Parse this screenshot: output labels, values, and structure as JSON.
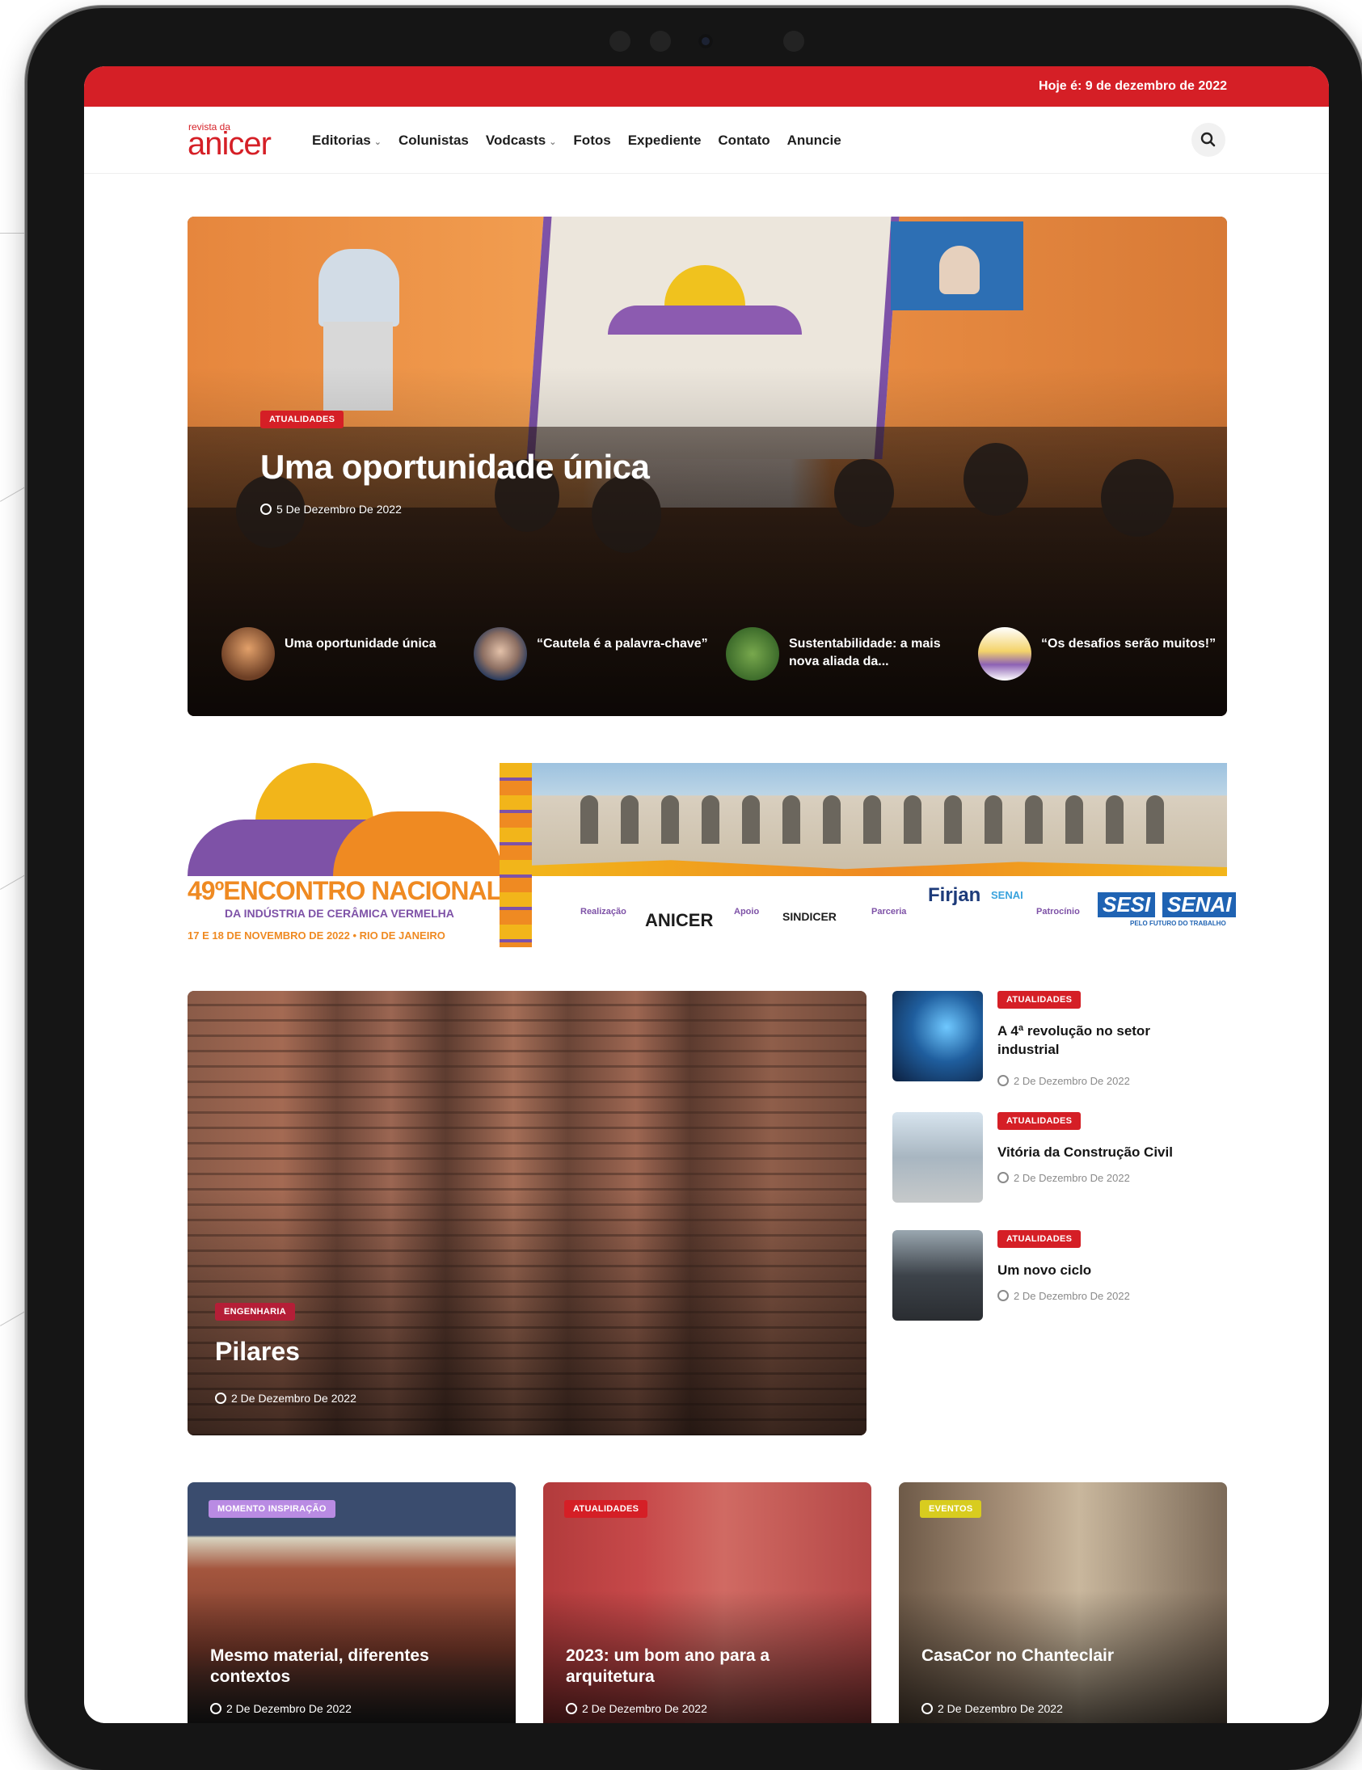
{
  "top_bar": {
    "date": "Hoje é: 9 de dezembro de 2022"
  },
  "header": {
    "logo_small": "revista da",
    "logo_big": "anicer",
    "nav": [
      {
        "label": "Editorias",
        "dropdown": true
      },
      {
        "label": "Colunistas",
        "dropdown": false
      },
      {
        "label": "Vodcasts",
        "dropdown": true
      },
      {
        "label": "Fotos",
        "dropdown": false
      },
      {
        "label": "Expediente",
        "dropdown": false
      },
      {
        "label": "Contato",
        "dropdown": false
      },
      {
        "label": "Anuncie",
        "dropdown": false
      }
    ],
    "search_icon": "search-icon"
  },
  "hero": {
    "category": "ATUALIDADES",
    "title": "Uma oportunidade única",
    "date": "5 De Dezembro De 2022",
    "strip": [
      {
        "title": "Uma oportunidade única"
      },
      {
        "title": "“Cautela é a palavra-chave”"
      },
      {
        "title": "Sustentabilidade: a mais nova aliada da..."
      },
      {
        "title": "“Os desafios serão muitos!”"
      }
    ]
  },
  "banner": {
    "event_title": "49ºENCONTRO NACIONAL",
    "event_subtitle": "DA INDÚSTRIA DE CERÂMICA VERMELHA",
    "event_dates": "17 E 18 DE NOVEMBRO DE 2022 • RIO DE JANEIRO",
    "label_realizacao": "Realização",
    "logo_anicer": "ANICER",
    "label_apoio": "Apoio",
    "logo_sindicer": "SINDICER",
    "label_parceria": "Parceria",
    "logo_firjan": "Firjan",
    "logo_firjan_senai": "SENAI",
    "label_patrocinio": "Patrocínio",
    "logo_sesi": "SESI",
    "logo_senai": "SENAI",
    "logo_tagline": "PELO FUTURO DO TRABALHO"
  },
  "featured": {
    "category": "ENGENHARIA",
    "title": "Pilares",
    "date": "2 De Dezembro De 2022"
  },
  "side_list": [
    {
      "category": "ATUALIDADES",
      "title": "A 4ª revolução no setor industrial",
      "date": "2 De Dezembro De 2022"
    },
    {
      "category": "ATUALIDADES",
      "title": "Vitória da Construção Civil",
      "date": "2 De Dezembro De 2022"
    },
    {
      "category": "ATUALIDADES",
      "title": "Um novo ciclo",
      "date": "2 De Dezembro De 2022"
    }
  ],
  "cards": [
    {
      "category": "MOMENTO INSPIRAÇÃO",
      "title": "Mesmo material, diferentes contextos",
      "date": "2 De Dezembro De 2022",
      "badge_color": "#b98be3"
    },
    {
      "category": "ATUALIDADES",
      "title": "2023: um bom ano para a arquitetura",
      "date": "2 De Dezembro De 2022",
      "badge_color": "#d51f26"
    },
    {
      "category": "EVENTOS",
      "title": "CasaCor no Chanteclair",
      "date": "2 De Dezembro De 2022",
      "badge_color": "#d8cc1f"
    }
  ],
  "colors": {
    "brand_red": "#d51f26",
    "text_dark": "#1e1e1e",
    "meta_gray": "#8a8a8a"
  }
}
